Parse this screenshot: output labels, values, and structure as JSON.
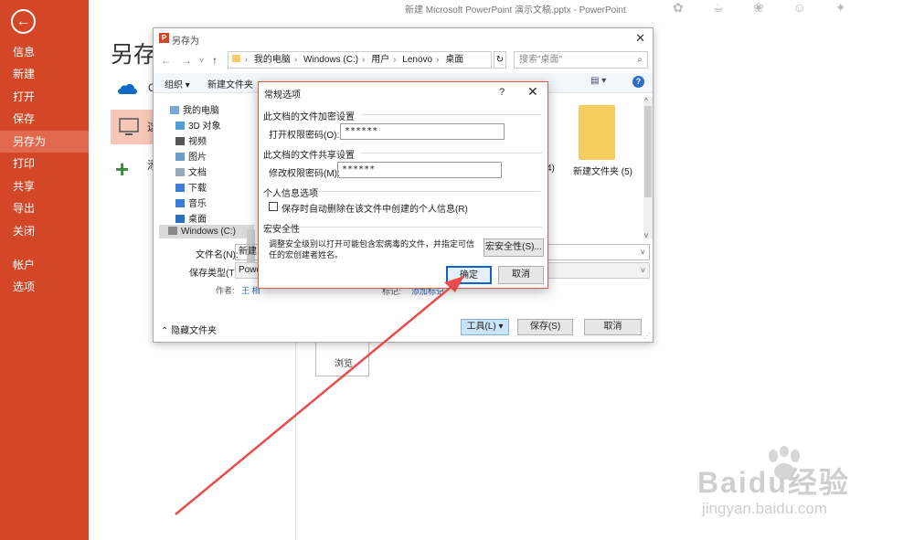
{
  "window_title": "新建 Microsoft PowerPoint 演示文稿.pptx - PowerPoint",
  "backstage": {
    "back_icon": "arrow-left-icon",
    "nav": [
      "信息",
      "新建",
      "打开",
      "保存",
      "另存为",
      "打印",
      "共享",
      "导出",
      "关闭",
      "帐户",
      "选项"
    ],
    "active_nav": "另存为",
    "title": "另存为",
    "onedrive_label": "O",
    "thispc_label": "这",
    "add_place_label": "添",
    "browse_label": "浏览"
  },
  "saveas_dialog": {
    "title": "另存为",
    "address": [
      "我的电脑",
      "Windows (C:)",
      "用户",
      "Lenovo",
      "桌面"
    ],
    "search_placeholder": "搜索\"桌面\"",
    "organize": "组织 ▾",
    "new_folder": "新建文件夹",
    "tree": [
      "我的电脑",
      "3D 对象",
      "视频",
      "图片",
      "文档",
      "下载",
      "音乐",
      "桌面",
      "Windows (C:)"
    ],
    "folder_label": "新建文件夹 (5)",
    "folder_left_label": "4)",
    "filename_label": "文件名(N):",
    "filename_value": "新建 I",
    "filetype_label": "保存类型(T):",
    "filetype_value": "Powe",
    "author_label": "作者:",
    "author_value": "王 相",
    "tag_label": "标记:",
    "tag_value": "添加标记",
    "hide_folders": "隐藏文件夹",
    "tools": "工具(L)",
    "save": "保存(S)",
    "cancel": "取消"
  },
  "general_options": {
    "title": "常规选项",
    "help": "?",
    "encrypt_section": "此文档的文件加密设置",
    "open_pw_label": "打开权限密码(O):",
    "open_pw_value": "******",
    "share_section": "此文档的文件共享设置",
    "modify_pw_label": "修改权限密码(M):",
    "modify_pw_value": "******",
    "privacy_section": "个人信息选项",
    "privacy_checkbox": "保存时自动删除在该文件中创建的个人信息(R)",
    "macro_section": "宏安全性",
    "macro_desc": "调整安全级别以打开可能包含宏病毒的文件，并指定可信任的宏创建者姓名。",
    "macro_button": "宏安全性(S)...",
    "ok": "确定",
    "cancel": "取消"
  },
  "watermark": {
    "logo": "Baidu经验",
    "url": "jingyan.baidu.com"
  },
  "colors": {
    "sidebar": "#d34727",
    "sidebar_active": "#e16a4e",
    "arrow": "#e84c4c",
    "folder": "#f6cd60"
  }
}
